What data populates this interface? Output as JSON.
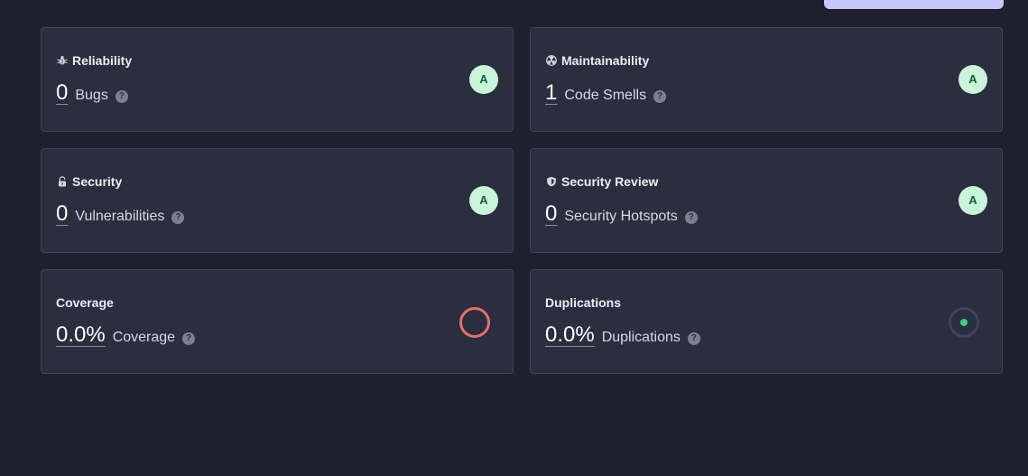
{
  "colors": {
    "background": "#1e2030",
    "card": "#2a2e3e",
    "grade_bg": "#c8f5d8",
    "grade_fg": "#1a5c35",
    "coverage_ring": "#e8706a",
    "dup_dot": "#3ecf78"
  },
  "cards": {
    "reliability": {
      "title": "Reliability",
      "icon": "bug-icon",
      "value": "0",
      "label": "Bugs",
      "grade": "A"
    },
    "maintainability": {
      "title": "Maintainability",
      "icon": "radiation-icon",
      "value": "1",
      "label": "Code Smells",
      "grade": "A"
    },
    "security": {
      "title": "Security",
      "icon": "lock-icon",
      "value": "0",
      "label": "Vulnerabilities",
      "grade": "A"
    },
    "security_review": {
      "title": "Security Review",
      "icon": "shield-icon",
      "value": "0",
      "label": "Security Hotspots",
      "grade": "A"
    },
    "coverage": {
      "title": "Coverage",
      "value": "0.0%",
      "label": "Coverage",
      "percent": 0
    },
    "duplications": {
      "title": "Duplications",
      "value": "0.0%",
      "label": "Duplications",
      "percent": 0
    }
  },
  "help_glyph": "?"
}
